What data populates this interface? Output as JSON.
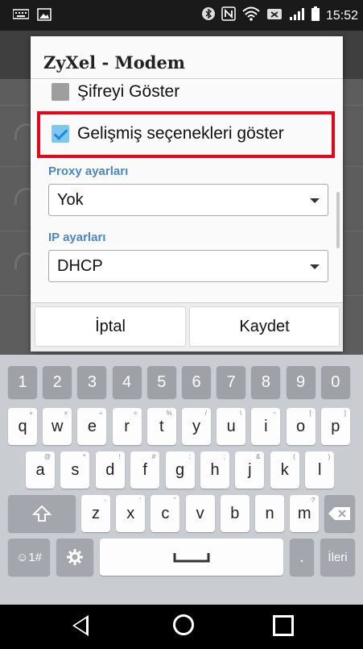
{
  "status_bar": {
    "time": "15:52"
  },
  "dialog": {
    "title": "ZyXel - Modem",
    "show_password_label": "Şifreyi Göster",
    "show_password_checked": false,
    "advanced_options_label": "Gelişmiş seçenekleri göster",
    "advanced_options_checked": true,
    "proxy_label": "Proxy ayarları",
    "proxy_value": "Yok",
    "ip_label": "IP ayarları",
    "ip_value": "DHCP",
    "cancel_label": "İptal",
    "save_label": "Kaydet",
    "highlight_color": "#e3071b",
    "accent_color": "#4a87c6"
  },
  "keyboard": {
    "number_row": [
      "1",
      "2",
      "3",
      "4",
      "5",
      "6",
      "7",
      "8",
      "9",
      "0"
    ],
    "row1": [
      "q",
      "w",
      "e",
      "r",
      "t",
      "y",
      "u",
      "i",
      "o",
      "p"
    ],
    "row1_hints": [
      "+",
      "×",
      "÷",
      "=",
      "%",
      "/",
      "\\",
      "~",
      "[",
      "]"
    ],
    "row2": [
      "a",
      "s",
      "d",
      "f",
      "g",
      "h",
      "j",
      "k",
      "l"
    ],
    "row2_hints": [
      "@",
      "*",
      "!",
      "#",
      ":",
      ";",
      "&",
      "(",
      ")"
    ],
    "row3": [
      "z",
      "x",
      "c",
      "v",
      "b",
      "n",
      "m"
    ],
    "row3_hints": [
      "-",
      "'",
      "\"",
      "",
      "",
      "",
      "?"
    ],
    "symbols_label": "☺1#",
    "enter_label": "İleri",
    "period_label": "."
  }
}
